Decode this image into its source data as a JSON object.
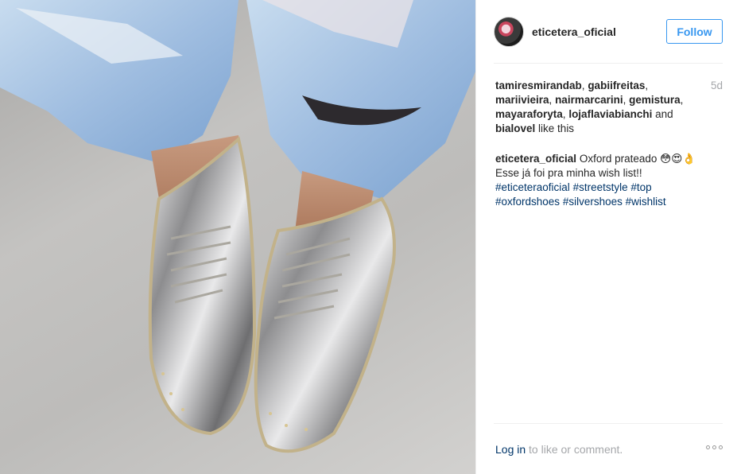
{
  "photo": {
    "alt_subject": "silver-oxford-shoes"
  },
  "header": {
    "username": "eticetera_oficial",
    "follow_label": "Follow"
  },
  "likes": {
    "names": [
      "tamiresmirandab",
      "gabiifreitas",
      "mariivieira",
      "nairmarcarini",
      "gemistura",
      "mayaraforyta",
      "lojaflaviabianchi",
      "bialovel"
    ],
    "and_text": "and",
    "suffix": "like this",
    "time": "5d"
  },
  "caption": {
    "author": "eticetera_oficial",
    "text_line1": "Oxford prateado 😳😍👌",
    "text_line2": "Esse já foi pra minha wish list!!",
    "hashtags": [
      "#eticeteraoficial",
      "#streetstyle",
      "#top",
      "#oxfordshoes",
      "#silvershoes",
      "#wishlist"
    ]
  },
  "footer": {
    "login_label": "Log in",
    "rest": "to like or comment.",
    "more_icon": "more-options-icon"
  },
  "colors": {
    "accent": "#3897f0",
    "link": "#003569",
    "muted": "#a5a7aa"
  }
}
